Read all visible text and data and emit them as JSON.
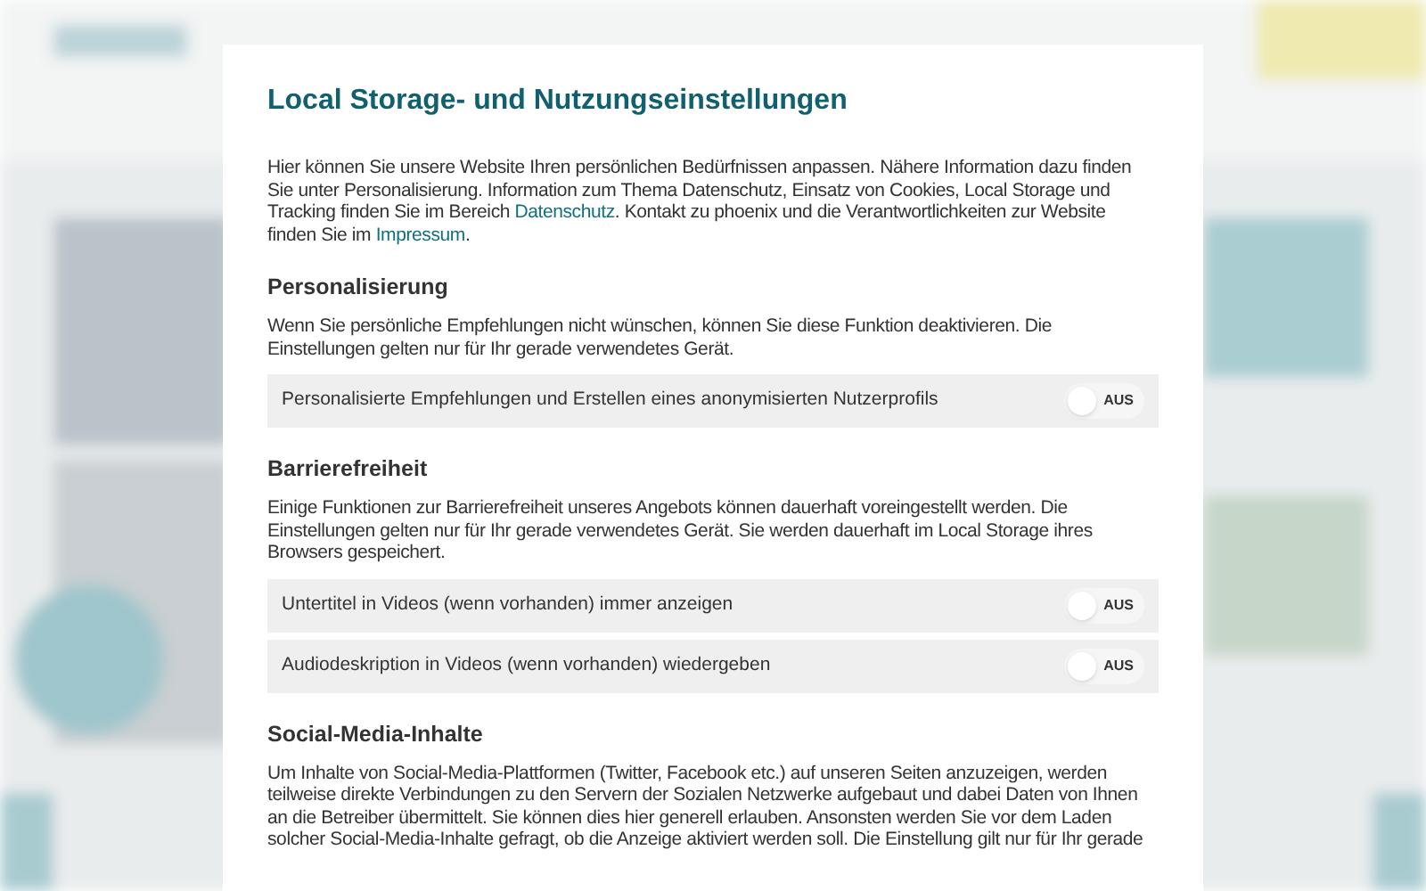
{
  "dialog": {
    "title": "Local Storage- und Nutzungseinstellungen",
    "intro": {
      "parts": [
        {
          "kind": "text",
          "text": "Hier können Sie unsere Website Ihren persönlichen Bedürfnissen anpassen. Nähere Information dazu finden Sie unter Personalisierung. Information zum Thema Datenschutz, Einsatz von Cookies, Local Storage und Tracking finden Sie im Bereich "
        },
        {
          "kind": "link",
          "text": "Datenschutz"
        },
        {
          "kind": "text",
          "text": ". Kontakt zu phoenix und die Verantwortlichkeiten zur Website finden Sie im "
        },
        {
          "kind": "link",
          "text": "Impressum"
        },
        {
          "kind": "text",
          "text": "."
        }
      ]
    },
    "sections": [
      {
        "heading": "Personalisierung",
        "text": "Wenn Sie persönliche Empfehlungen nicht wünschen, können Sie diese Funktion deaktivieren. Die Einstellungen gelten nur für Ihr gerade verwendetes Gerät.",
        "settings": [
          {
            "label": "Personalisierte Empfehlungen und Erstellen eines anonymisierten Nutzerprofils",
            "on": false,
            "state_label": "AUS"
          }
        ]
      },
      {
        "heading": "Barrierefreiheit",
        "text": "Einige Funktionen zur Barrierefreiheit unseres Angebots können dauerhaft voreingestellt werden. Die Einstellungen gelten nur für Ihr gerade verwendetes Gerät. Sie werden dauerhaft im Local Storage ihres Browsers gespeichert.",
        "settings": [
          {
            "label": "Untertitel in Videos (wenn vorhanden) immer anzeigen",
            "on": false,
            "state_label": "AUS"
          },
          {
            "label": "Audiodeskription in Videos (wenn vorhanden) wiedergeben",
            "on": false,
            "state_label": "AUS"
          }
        ]
      },
      {
        "heading": "Social-Media-Inhalte",
        "text": "Um Inhalte von Social-Media-Plattformen (Twitter, Facebook etc.) auf unseren Seiten anzuzeigen, werden teilweise direkte Verbindungen zu den Servern der Sozialen Netzwerke aufgebaut und dabei Daten von Ihnen an die Betreiber übermittelt. Sie können dies hier generell erlauben. Ansonsten werden Sie vor dem Laden solcher Social-Media-Inhalte gefragt, ob die Anzeige aktiviert werden soll. Die Einstellung gilt nur für Ihr gerade"
      }
    ]
  }
}
